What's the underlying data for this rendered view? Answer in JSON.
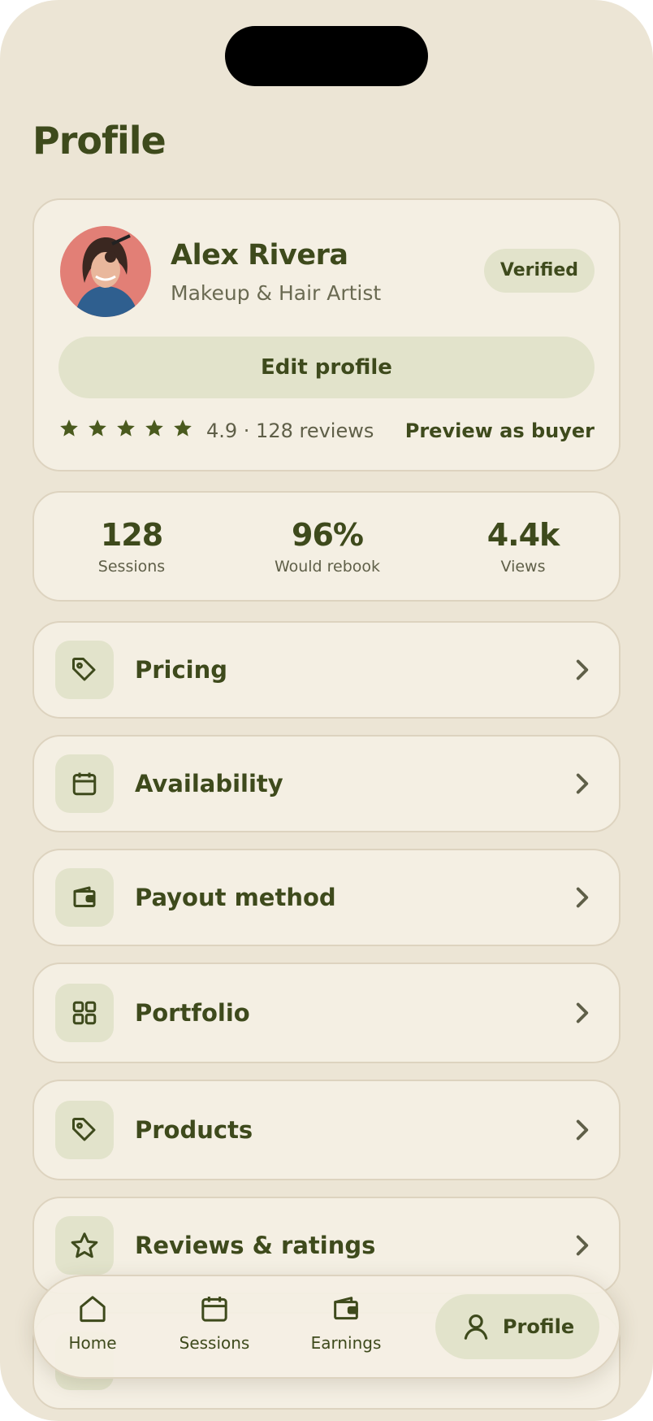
{
  "page": {
    "title": "Profile"
  },
  "profile": {
    "name": "Alex Rivera",
    "role": "Makeup & Hair Artist",
    "badge": "Verified",
    "edit_label": "Edit profile",
    "rating": 4.9,
    "rating_text": "4.9 · 128 reviews",
    "preview_label": "Preview as buyer",
    "avatar_icon": "avatar-photo"
  },
  "stats": [
    {
      "value": "128",
      "label": "Sessions"
    },
    {
      "value": "96%",
      "label": "Would rebook"
    },
    {
      "value": "4.4k",
      "label": "Views"
    }
  ],
  "menu": [
    {
      "label": "Pricing",
      "icon": "tag-icon"
    },
    {
      "label": "Availability",
      "icon": "calendar-icon"
    },
    {
      "label": "Payout method",
      "icon": "wallet-icon"
    },
    {
      "label": "Portfolio",
      "icon": "grid-icon"
    },
    {
      "label": "Products",
      "icon": "tag-icon"
    },
    {
      "label": "Reviews & ratings",
      "icon": "star-icon"
    }
  ],
  "nav": {
    "items": [
      {
        "label": "Home",
        "icon": "home-icon"
      },
      {
        "label": "Sessions",
        "icon": "calendar-icon"
      },
      {
        "label": "Earnings",
        "icon": "wallet-icon"
      }
    ],
    "active": {
      "label": "Profile",
      "icon": "user-icon"
    }
  },
  "colors": {
    "background": "#ece5d5",
    "card": "#f4efe3",
    "accent": "#3e4a1c",
    "pill": "#e2e3cb"
  }
}
